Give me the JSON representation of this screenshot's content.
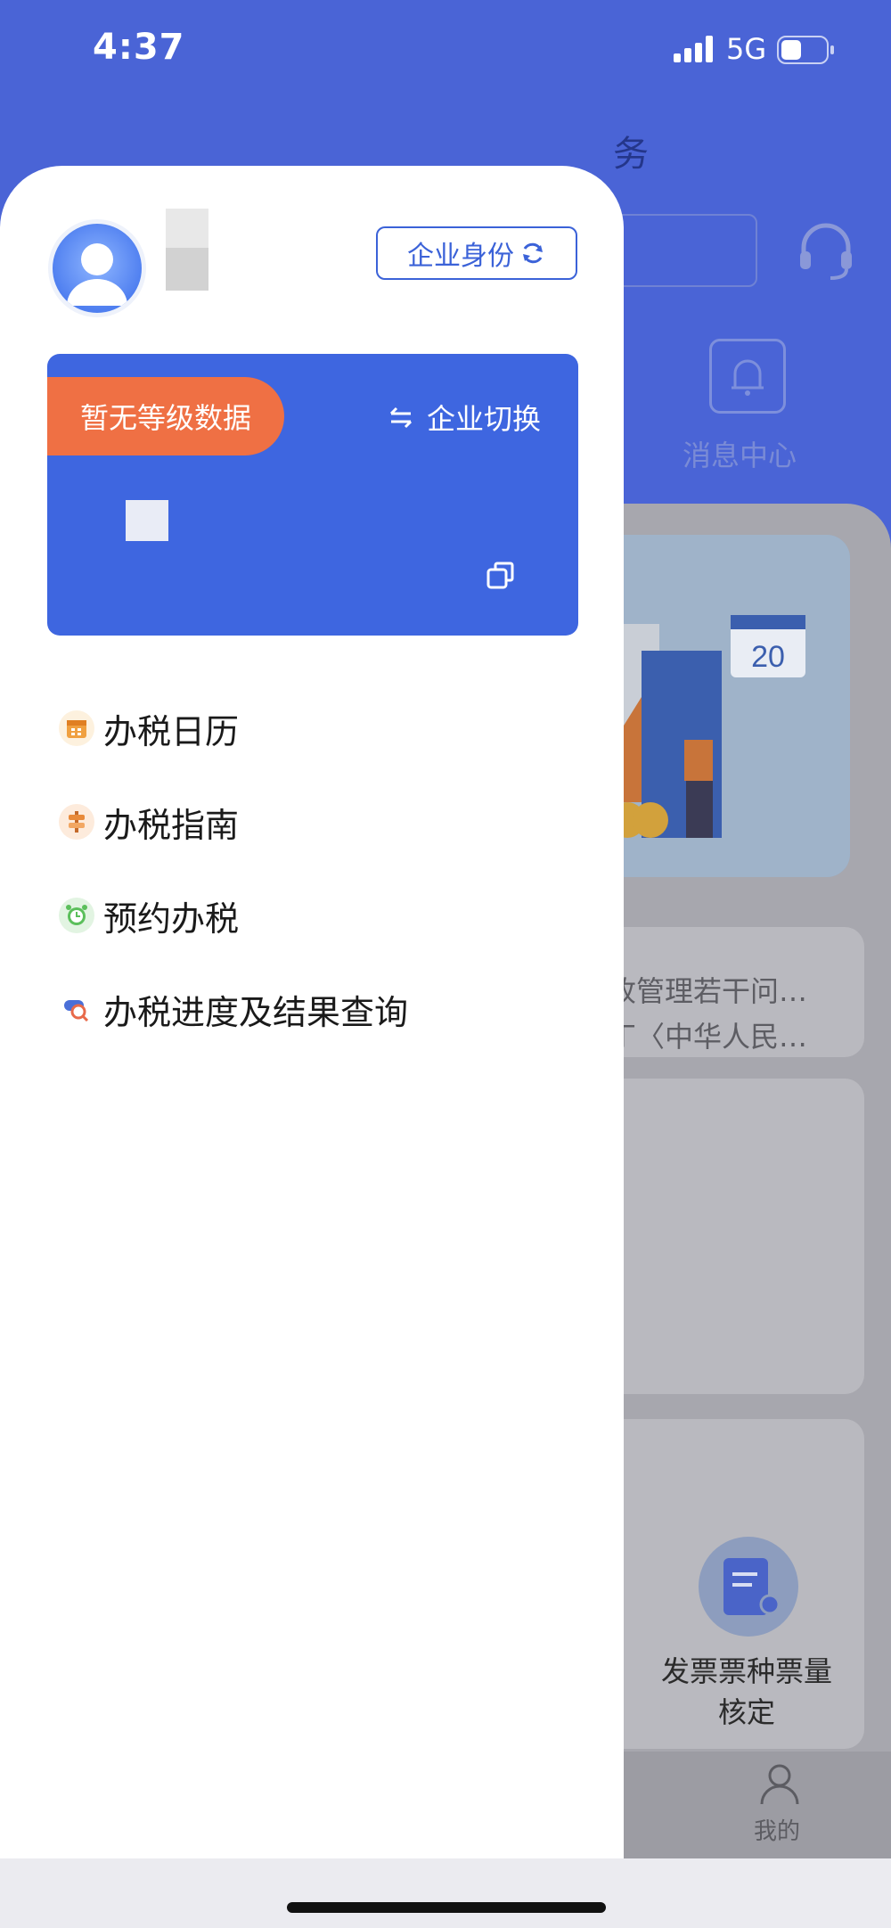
{
  "status_bar": {
    "time": "4:37",
    "network": "5G",
    "battery_level": 0.45
  },
  "drawer": {
    "identity_button": "企业身份",
    "company_card": {
      "level_badge": "暂无等级数据",
      "switch_company": "企业切换"
    },
    "menu": [
      {
        "label": "办税日历",
        "icon": "calendar-icon",
        "color": "#f0a040"
      },
      {
        "label": "办税指南",
        "icon": "signpost-icon",
        "color": "#e88a3a"
      },
      {
        "label": "预约办税",
        "icon": "alarm-clock-icon",
        "color": "#5bbf5b"
      },
      {
        "label": "办税进度及结果查询",
        "icon": "search-progress-icon",
        "color": "#4a6fd8"
      }
    ]
  },
  "background": {
    "header_title_fragment": "务",
    "message_center": "消息中心",
    "banner_date": "20",
    "news": [
      "收管理若干问…",
      "丁〈中华人民…"
    ],
    "invoice_service": "发票票种票量核定",
    "tab_mine": "我的"
  },
  "colors": {
    "brand_blue": "#4a64d6",
    "card_blue": "#3e66e0",
    "badge_orange": "#ef7044"
  }
}
